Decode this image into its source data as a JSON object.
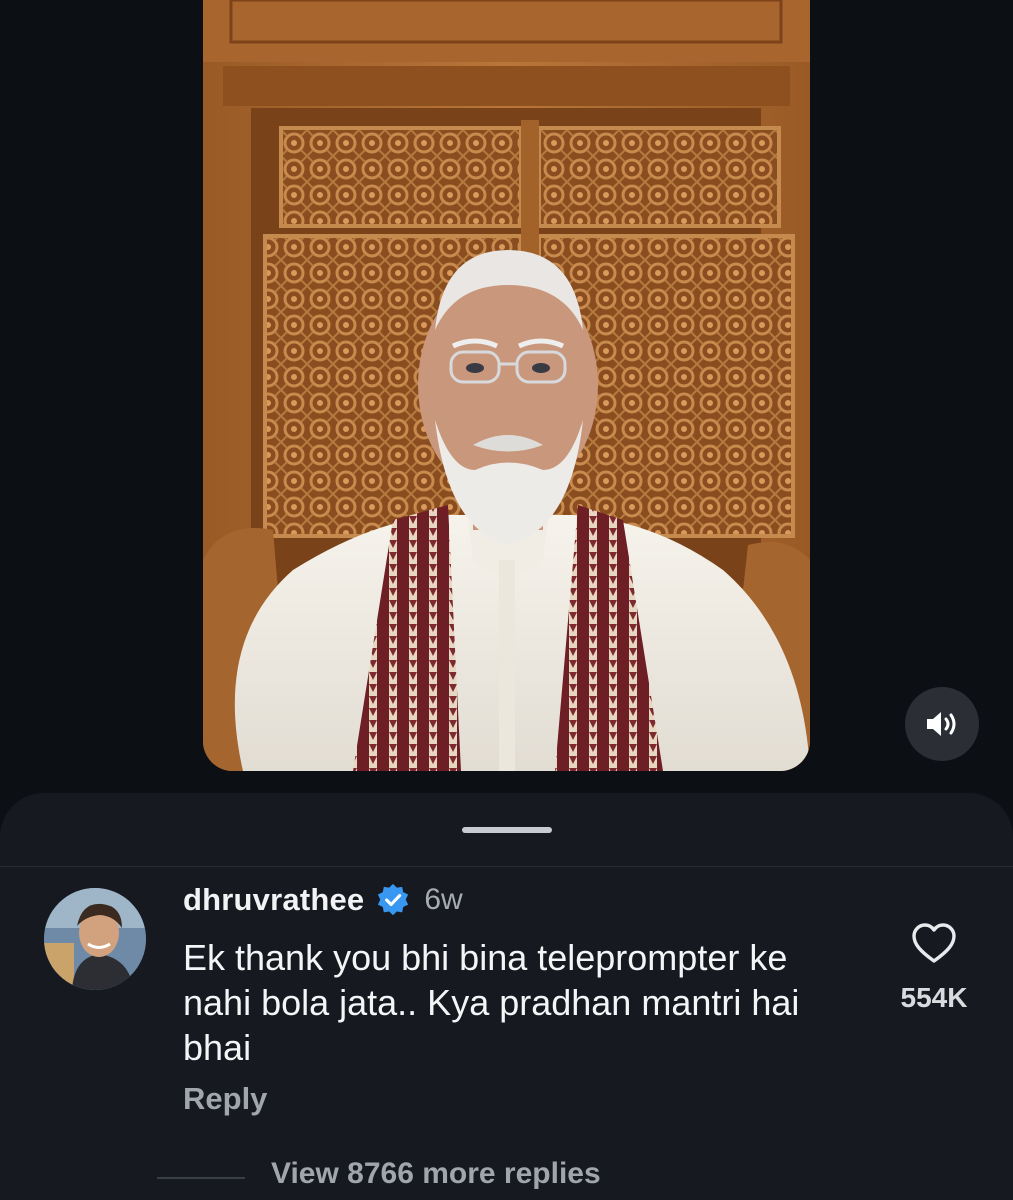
{
  "video": {
    "sound_icon": "speaker-icon"
  },
  "comment": {
    "username": "dhruvrathee",
    "verified_icon": "verified-badge-icon",
    "time_ago": "6w",
    "text": "Ek thank you bhi bina teleprompter ke nahi bola jata.. Kya pradhan mantri hai bhai",
    "like_icon": "heart-icon",
    "like_count": "554K",
    "reply_label": "Reply",
    "view_replies_label": "View 8766 more replies"
  },
  "colors": {
    "background": "#0c1015",
    "sheet": "#16191f",
    "verified_blue": "#3897f0",
    "muted_text": "#a1a5ac"
  }
}
